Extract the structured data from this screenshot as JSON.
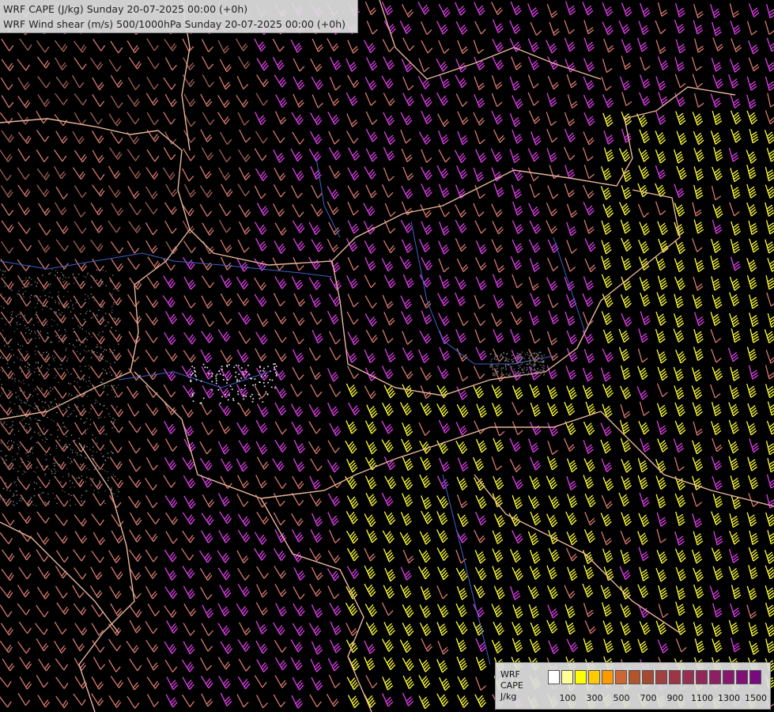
{
  "header": {
    "line1": "WRF CAPE (J/kg) Sunday 20-07-2025 00:00 (+0h)",
    "line2": "WRF Wind shear (m/s) 500/1000hPa Sunday 20-07-2025 00:00 (+0h)"
  },
  "legend": {
    "label_lines": [
      "WRF",
      "CAPE",
      "J/kg"
    ],
    "ticks": [
      "100",
      "300",
      "500",
      "700",
      "900",
      "1100",
      "1300",
      "1500"
    ],
    "colors": [
      "#ffffff",
      "#ffff99",
      "#ffff00",
      "#ffcc00",
      "#ff9900",
      "#cc6633",
      "#b0552c",
      "#a44a30",
      "#a04040",
      "#9c3545",
      "#963050",
      "#92285a",
      "#8c2062",
      "#86186c",
      "#801076",
      "#780a80"
    ]
  },
  "map_colors": {
    "barb_low": "#d87a70",
    "barb_brown": "#a56058",
    "barb_mid": "#e040e8",
    "barb_high": "#ffff33",
    "border": "#e8b49a",
    "river": "#4060c8"
  }
}
